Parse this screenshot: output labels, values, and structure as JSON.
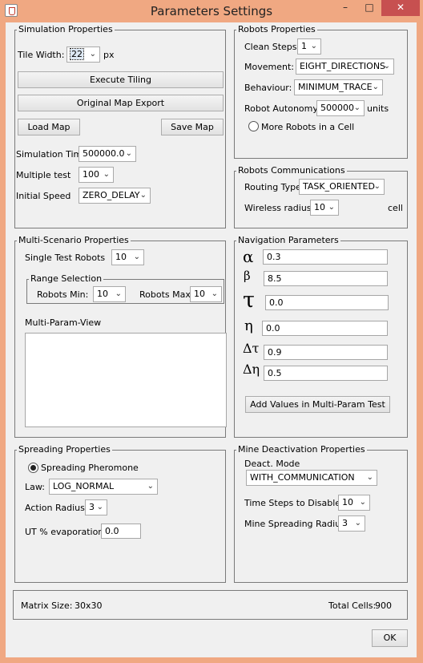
{
  "window": {
    "title": "Parameters Settings",
    "minimize": "–",
    "maximize": "□",
    "close": "✕"
  },
  "simulation": {
    "group_title": "Simulation Properties",
    "tile_width_label": "Tile Width:",
    "tile_width_value": "22",
    "tile_width_unit": "px",
    "execute_tiling": "Execute Tiling",
    "original_map_export": "Original Map Export",
    "load_map": "Load Map",
    "save_map": "Save Map",
    "sim_time_label": "Simulation Time",
    "sim_time_value": "500000.0",
    "multiple_test_label": "Multiple test",
    "multiple_test_value": "100",
    "initial_speed_label": "Initial Speed",
    "initial_speed_value": "ZERO_DELAY"
  },
  "robots": {
    "group_title": "Robots Properties",
    "clean_steps_label": "Clean Steps:",
    "clean_steps_value": "1",
    "movement_label": "Movement:",
    "movement_value": "EIGHT_DIRECTIONS",
    "behaviour_label": "Behaviour:",
    "behaviour_value": "MINIMUM_TRACE",
    "autonomy_label": "Robot Autonomy:",
    "autonomy_value": "500000",
    "autonomy_unit": "units",
    "more_robots_label": "More Robots in a Cell"
  },
  "comms": {
    "group_title": "Robots Communications",
    "routing_label": "Routing Type",
    "routing_value": "TASK_ORIENTED",
    "wireless_label": "Wireless radius:",
    "wireless_value": "10",
    "wireless_unit": "cell"
  },
  "multi": {
    "group_title": "Multi-Scenario Properties",
    "single_test_label": "Single Test Robots",
    "single_test_value": "10",
    "range_title": "Range Selection",
    "robots_min_label": "Robots Min:",
    "robots_min_value": "10",
    "robots_max_label": "Robots Max",
    "robots_max_value": "10",
    "multi_param_view_label": "Multi-Param-View"
  },
  "nav": {
    "group_title": "Navigation Parameters",
    "params": [
      {
        "symbol": "α",
        "value": "0.3"
      },
      {
        "symbol": "β",
        "value": "8.5"
      },
      {
        "symbol": "τ",
        "value": "0.0"
      },
      {
        "symbol": "η",
        "value": "0.0"
      },
      {
        "symbol": "Δτ",
        "value": "0.9"
      },
      {
        "symbol": "Δη",
        "value": "0.5"
      }
    ],
    "add_button": "Add Values in Multi-Param Test"
  },
  "spreading": {
    "group_title": "Spreading Properties",
    "pheromone_label": "Spreading Pheromone",
    "law_label": "Law:",
    "law_value": "LOG_NORMAL",
    "action_radius_label": "Action Radius:",
    "action_radius_value": "3",
    "evaporation_label": "UT % evaporation",
    "evaporation_value": "0.0"
  },
  "mine": {
    "group_title": "Mine Deactivation Properties",
    "mode_label": "Deact. Mode",
    "mode_value": "WITH_COMMUNICATION",
    "time_steps_label": "Time Steps to Disable:",
    "time_steps_value": "10",
    "spreading_radius_label": "Mine Spreading Radius:",
    "spreading_radius_value": "3"
  },
  "footer": {
    "matrix_size_label": "Matrix Size:",
    "matrix_size_value": "30x30",
    "total_cells_label": "Total Cells:",
    "total_cells_value": "900",
    "ok": "OK"
  }
}
